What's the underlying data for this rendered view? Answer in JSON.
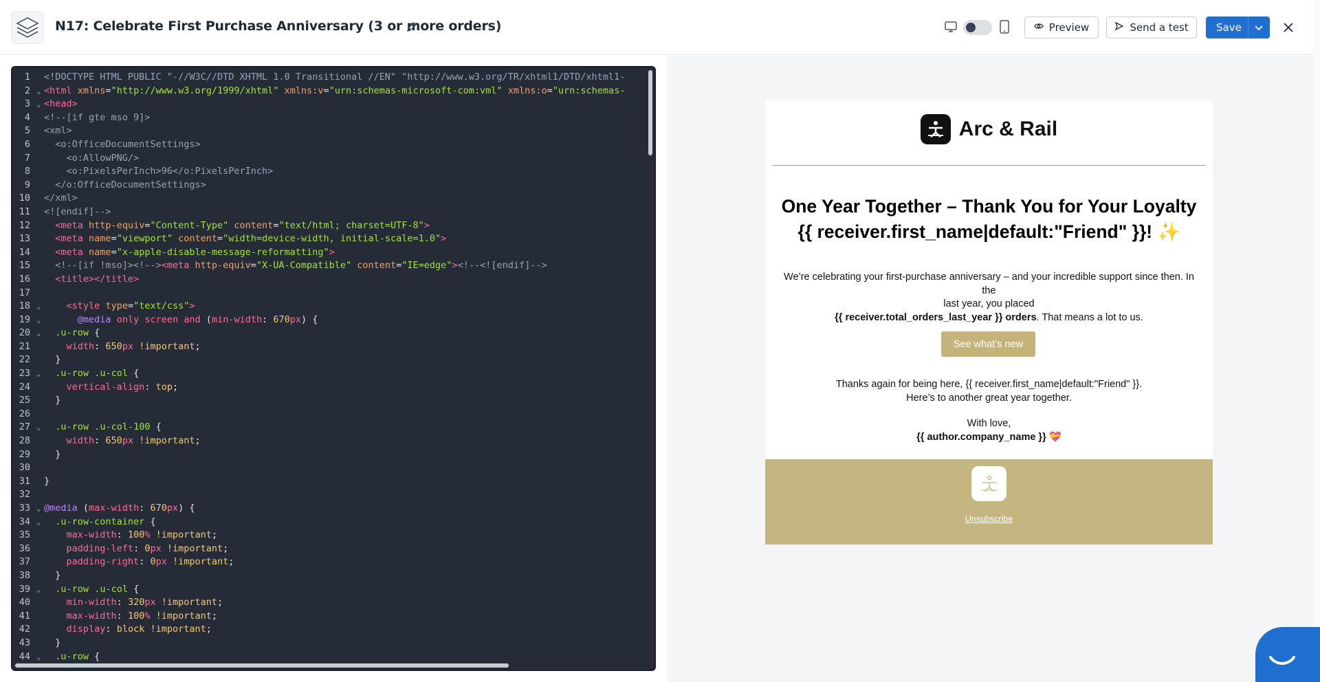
{
  "header": {
    "title": "N17: Celebrate First Purchase Anniversary (3 or more orders)",
    "preview_label": "Preview",
    "send_test_label": "Send a test",
    "save_label": "Save"
  },
  "editor": {
    "lines": [
      {
        "n": "1",
        "fold": "",
        "html": "<span class='c'>&lt;!DOCTYPE HTML PUBLIC \"-//W3C//DTD XHTML 1.0 Transitional //EN\" \"http://www.w3.org/TR/xhtml1/DTD/xhtml1-</span>"
      },
      {
        "n": "2",
        "fold": "⌄",
        "html": "<span class='t'>&lt;html</span> <span class='a'>xmlns</span>=<span class='s'>\"http://www.w3.org/1999/xhtml\"</span> <span class='a'>xmlns:v</span>=<span class='s'>\"urn:schemas-microsoft-com:vml\"</span> <span class='a'>xmlns:o</span>=<span class='s'>\"urn:schemas-</span>"
      },
      {
        "n": "3",
        "fold": "⌄",
        "html": "<span class='t'>&lt;head&gt;</span>"
      },
      {
        "n": "4",
        "fold": "",
        "html": "<span class='c'>&lt;!--[if gte mso 9]&gt;</span>"
      },
      {
        "n": "5",
        "fold": "",
        "html": "<span class='c'>&lt;xml&gt;</span>"
      },
      {
        "n": "6",
        "fold": "",
        "html": "<span class='c'>  &lt;o:OfficeDocumentSettings&gt;</span>"
      },
      {
        "n": "7",
        "fold": "",
        "html": "<span class='c'>    &lt;o:AllowPNG/&gt;</span>"
      },
      {
        "n": "8",
        "fold": "",
        "html": "<span class='c'>    &lt;o:PixelsPerInch&gt;96&lt;/o:PixelsPerInch&gt;</span>"
      },
      {
        "n": "9",
        "fold": "",
        "html": "<span class='c'>  &lt;/o:OfficeDocumentSettings&gt;</span>"
      },
      {
        "n": "10",
        "fold": "",
        "html": "<span class='c'>&lt;/xml&gt;</span>"
      },
      {
        "n": "11",
        "fold": "",
        "html": "<span class='c'>&lt;![endif]--&gt;</span>"
      },
      {
        "n": "12",
        "fold": "",
        "html": "  <span class='t'>&lt;meta</span> <span class='a'>http-equiv</span>=<span class='s'>\"Content-Type\"</span> <span class='a'>content</span>=<span class='s'>\"text/html; charset=UTF-8\"</span><span class='t'>&gt;</span>"
      },
      {
        "n": "13",
        "fold": "",
        "html": "  <span class='t'>&lt;meta</span> <span class='a'>name</span>=<span class='s'>\"viewport\"</span> <span class='a'>content</span>=<span class='s'>\"width=device-width, initial-scale=1.0\"</span><span class='t'>&gt;</span>"
      },
      {
        "n": "14",
        "fold": "",
        "html": "  <span class='t'>&lt;meta</span> <span class='a'>name</span>=<span class='s'>\"x-apple-disable-message-reformatting\"</span><span class='t'>&gt;</span>"
      },
      {
        "n": "15",
        "fold": "",
        "html": "  <span class='c'>&lt;!--[if !mso]&gt;&lt;!--&gt;</span><span class='t'>&lt;meta</span> <span class='a'>http-equiv</span>=<span class='s'>\"X-UA-Compatible\"</span> <span class='a'>content</span>=<span class='s'>\"IE=edge\"</span><span class='t'>&gt;</span><span class='c'>&lt;!--&lt;![endif]--&gt;</span>"
      },
      {
        "n": "16",
        "fold": "",
        "html": "  <span class='t'>&lt;title&gt;&lt;/title&gt;</span>"
      },
      {
        "n": "17",
        "fold": "",
        "html": ""
      },
      {
        "n": "18",
        "fold": "⌄",
        "html": "    <span class='t'>&lt;style</span> <span class='a'>type</span>=<span class='s'>\"text/css\"</span><span class='t'>&gt;</span>"
      },
      {
        "n": "19",
        "fold": "⌄",
        "html": "      <span class='k'>@media</span> <span class='p'>only</span> <span class='p'>screen</span> <span class='p'>and</span> (<span class='p'>min-width</span>: <span class='n'>670</span><span class='p'>px</span>) {"
      },
      {
        "n": "20",
        "fold": "⌄",
        "html": "  <span class='s'>.u-row</span> {"
      },
      {
        "n": "21",
        "fold": "",
        "html": "    <span class='p'>width</span>: <span class='n'>650</span><span class='p'>px</span> <span class='n'>!important</span>;"
      },
      {
        "n": "22",
        "fold": "",
        "html": "  }"
      },
      {
        "n": "23",
        "fold": "⌄",
        "html": "  <span class='s'>.u-row</span> <span class='s'>.u-col</span> {"
      },
      {
        "n": "24",
        "fold": "",
        "html": "    <span class='p'>vertical-align</span>: <span class='n'>top</span>;"
      },
      {
        "n": "25",
        "fold": "",
        "html": "  }"
      },
      {
        "n": "26",
        "fold": "",
        "html": ""
      },
      {
        "n": "27",
        "fold": "⌄",
        "html": "  <span class='s'>.u-row</span> <span class='s'>.u-col-100</span> {"
      },
      {
        "n": "28",
        "fold": "",
        "html": "    <span class='p'>width</span>: <span class='n'>650</span><span class='p'>px</span> <span class='n'>!important</span>;"
      },
      {
        "n": "29",
        "fold": "",
        "html": "  }"
      },
      {
        "n": "30",
        "fold": "",
        "html": ""
      },
      {
        "n": "31",
        "fold": "",
        "html": "}"
      },
      {
        "n": "32",
        "fold": "",
        "html": ""
      },
      {
        "n": "33",
        "fold": "⌄",
        "html": "<span class='k'>@media</span> (<span class='p'>max-width</span>: <span class='n'>670</span><span class='p'>px</span>) {"
      },
      {
        "n": "34",
        "fold": "⌄",
        "html": "  <span class='s'>.u-row-container</span> {"
      },
      {
        "n": "35",
        "fold": "",
        "html": "    <span class='p'>max-width</span>: <span class='n'>100</span><span class='p'>%</span> <span class='n'>!important</span>;"
      },
      {
        "n": "36",
        "fold": "",
        "html": "    <span class='p'>padding-left</span>: <span class='n'>0</span><span class='p'>px</span> <span class='n'>!important</span>;"
      },
      {
        "n": "37",
        "fold": "",
        "html": "    <span class='p'>padding-right</span>: <span class='n'>0</span><span class='p'>px</span> <span class='n'>!important</span>;"
      },
      {
        "n": "38",
        "fold": "",
        "html": "  }"
      },
      {
        "n": "39",
        "fold": "⌄",
        "html": "  <span class='s'>.u-row</span> <span class='s'>.u-col</span> {"
      },
      {
        "n": "40",
        "fold": "",
        "html": "    <span class='p'>min-width</span>: <span class='n'>320</span><span class='p'>px</span> <span class='n'>!important</span>;"
      },
      {
        "n": "41",
        "fold": "",
        "html": "    <span class='p'>max-width</span>: <span class='n'>100</span><span class='p'>%</span> <span class='n'>!important</span>;"
      },
      {
        "n": "42",
        "fold": "",
        "html": "    <span class='p'>display</span>: <span class='n'>block</span> <span class='n'>!important</span>;"
      },
      {
        "n": "43",
        "fold": "",
        "html": "  }"
      },
      {
        "n": "44",
        "fold": "⌄",
        "html": "  <span class='s'>.u-row</span> {"
      }
    ]
  },
  "email": {
    "brand_name": "Arc & Rail",
    "headline_line1": "One Year Together – Thank You for Your Loyalty",
    "headline_line2": "{{ receiver.first_name|default:\"Friend\" }}!",
    "headline_emoji": "✨",
    "body_line1": "We’re celebrating your first-purchase anniversary – and your incredible support since then. In the",
    "body_line2": "last year, you placed",
    "body_bold": "{{ receiver.total_orders_last_year }} orders",
    "body_tail": ". That means a lot to us.",
    "cta_label": "See what’s new",
    "thanks_line1": "Thanks again for being here, {{ receiver.first_name|default:\"Friend\" }}.",
    "thanks_line2": "Here’s to another great year together.",
    "signoff": "With love,",
    "company": "{{ author.company_name }}",
    "company_emoji": "💝",
    "unsubscribe": "Unsubscribe"
  },
  "colors": {
    "accent_blue": "#1f6fd0",
    "editor_bg": "#252b37",
    "footer_tan": "#c5b581",
    "cta_tan": "#c4b37a"
  },
  "icons": [
    "layers-icon",
    "pencil-icon",
    "desktop-icon",
    "mobile-icon",
    "eye-icon",
    "send-icon",
    "chevron-down-icon",
    "close-icon",
    "chat-icon"
  ]
}
